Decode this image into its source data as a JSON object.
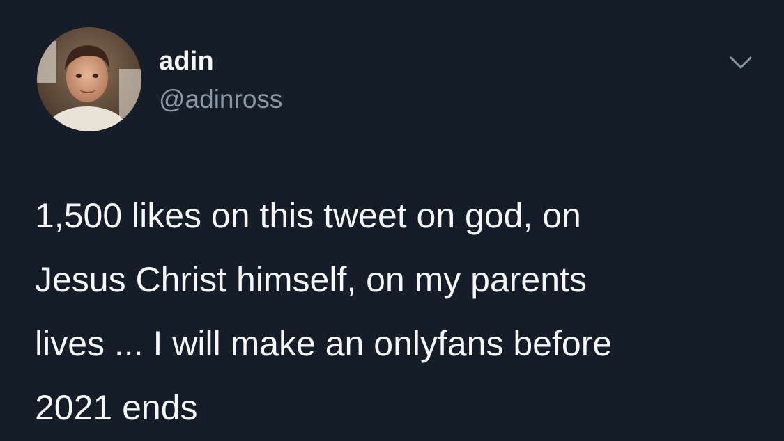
{
  "author": {
    "display_name": "adin",
    "handle": "@adinross",
    "avatar_icon": "profile-photo-avatar"
  },
  "menu": {
    "icon": "chevron-down-icon"
  },
  "tweet": {
    "lines": [
      "1,500 likes on this tweet on god, on",
      "Jesus Christ himself, on my parents",
      "lives ... I will make an onlyfans before",
      "2021 ends"
    ]
  },
  "colors": {
    "background": "#151d28",
    "text_primary": "#f5f7f9",
    "text_secondary": "#8b98a5"
  }
}
